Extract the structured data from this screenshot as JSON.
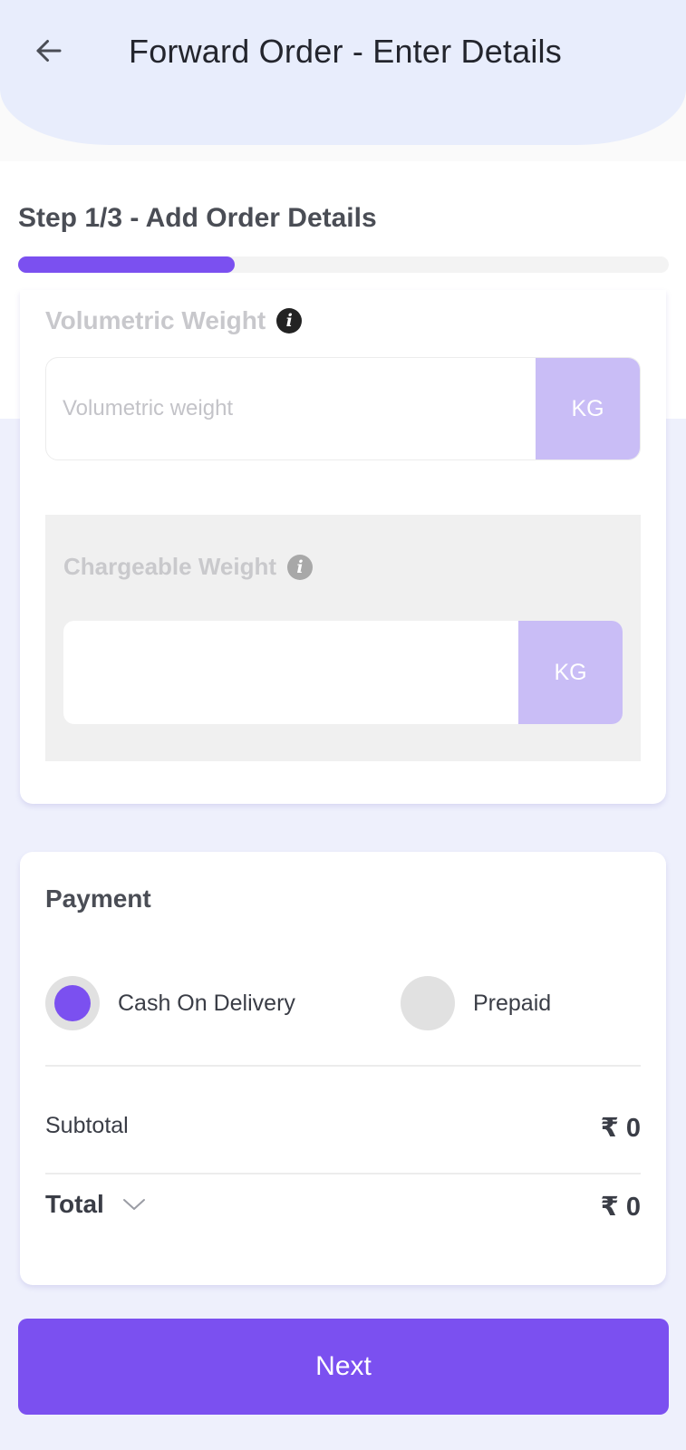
{
  "header": {
    "title": "Forward Order - Enter Details",
    "back_icon": "arrow-left-icon"
  },
  "step": {
    "label": "Step 1/3 - Add Order Details",
    "progress_fraction": 0.333,
    "accent_color": "#7b50f0"
  },
  "volumetric": {
    "title": "Volumetric Weight",
    "info_icon": "info-icon",
    "info_glyph": "i",
    "placeholder": "Volumetric weight",
    "value": "",
    "unit": "KG"
  },
  "chargeable": {
    "title": "Chargeable Weight",
    "info_icon": "info-icon",
    "info_glyph": "i",
    "value": "",
    "unit": "KG"
  },
  "payment": {
    "title": "Payment",
    "options": [
      {
        "label": "Cash On Delivery",
        "selected": true
      },
      {
        "label": "Prepaid",
        "selected": false
      }
    ],
    "subtotal_label": "Subtotal",
    "subtotal_value": "₹ 0",
    "total_label": "Total",
    "total_value": "₹ 0",
    "total_expand_icon": "chevron-down-icon"
  },
  "footer": {
    "next_label": "Next"
  }
}
